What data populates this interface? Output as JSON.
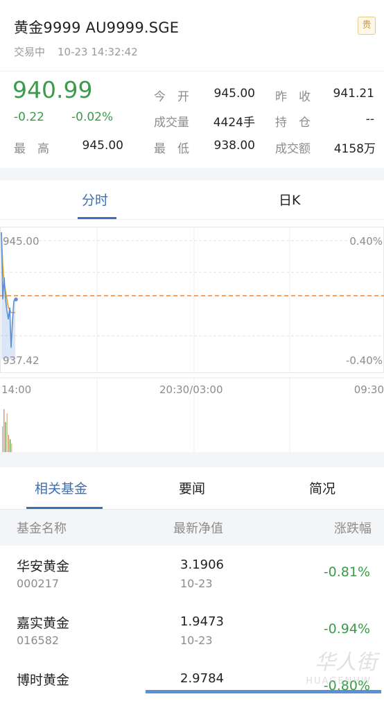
{
  "header": {
    "title": "黄金9999 AU9999.SGE",
    "status": "交易中",
    "datetime": "10-23 14:32:42",
    "badge": "贵"
  },
  "quote": {
    "price": "940.99",
    "change": "-0.22",
    "change_pct": "-0.02%",
    "fields": {
      "open_label": "今　开",
      "open": "945.00",
      "prev_close_label": "昨　收",
      "prev_close": "941.21",
      "volume_label": "成交量",
      "volume": "4424手",
      "position_label": "持　仓",
      "position": "--",
      "high_label": "最　高",
      "high": "945.00",
      "low_label": "最　低",
      "low": "938.00",
      "turnover_label": "成交额",
      "turnover": "4158万"
    }
  },
  "chart_tabs": [
    "分时",
    "日K"
  ],
  "chart": {
    "y_top_label": "945.00",
    "y_bottom_label": "937.42",
    "pct_top_label": "0.40%",
    "pct_bottom_label": "-0.40%",
    "x_labels": [
      "14:00",
      "20:30/03:00",
      "09:30"
    ]
  },
  "chart_data": {
    "type": "line",
    "title": "",
    "xlabel": "",
    "ylabel": "",
    "ylim": [
      937.42,
      945.0
    ],
    "reference_price": 941.21,
    "series": [
      {
        "x": [
          0,
          1,
          2,
          3,
          4,
          5,
          6,
          7,
          8,
          9,
          10
        ],
        "values": [
          945.0,
          941.0,
          942.3,
          941.0,
          940.3,
          939.8,
          940.5,
          938.1,
          939.7,
          940.9,
          940.99
        ]
      },
      {
        "x": [
          0,
          1,
          2,
          3,
          4,
          5,
          6,
          7,
          8,
          9,
          10
        ],
        "values": [
          945.0,
          943.0,
          942.0,
          941.5,
          941.0,
          940.5,
          940.4,
          940.2,
          940.2,
          940.2,
          940.2
        ]
      }
    ],
    "volume": [
      6,
      10,
      7,
      9,
      4,
      3,
      2
    ]
  },
  "colors": {
    "accent": "#3b6fb6",
    "down": "#3a9b4a",
    "avg_line": "#d9a520",
    "ref_line": "#e8833a"
  },
  "fund_tabs": [
    "相关基金",
    "要闻",
    "简况"
  ],
  "fund_table": {
    "headers": [
      "基金名称",
      "最新净值",
      "涨跌幅"
    ],
    "rows": [
      {
        "name": "华安黄金",
        "code": "000217",
        "nav": "3.1906",
        "date": "10-23",
        "change": "-0.81%"
      },
      {
        "name": "嘉实黄金",
        "code": "016582",
        "nav": "1.9473",
        "date": "10-23",
        "change": "-0.94%"
      },
      {
        "name": "博时黄金",
        "code": "",
        "nav": "2.9784",
        "date": "",
        "change": "-0.80%"
      }
    ]
  },
  "watermark": {
    "main": "华人街",
    "sub": "HUAGENHW"
  }
}
